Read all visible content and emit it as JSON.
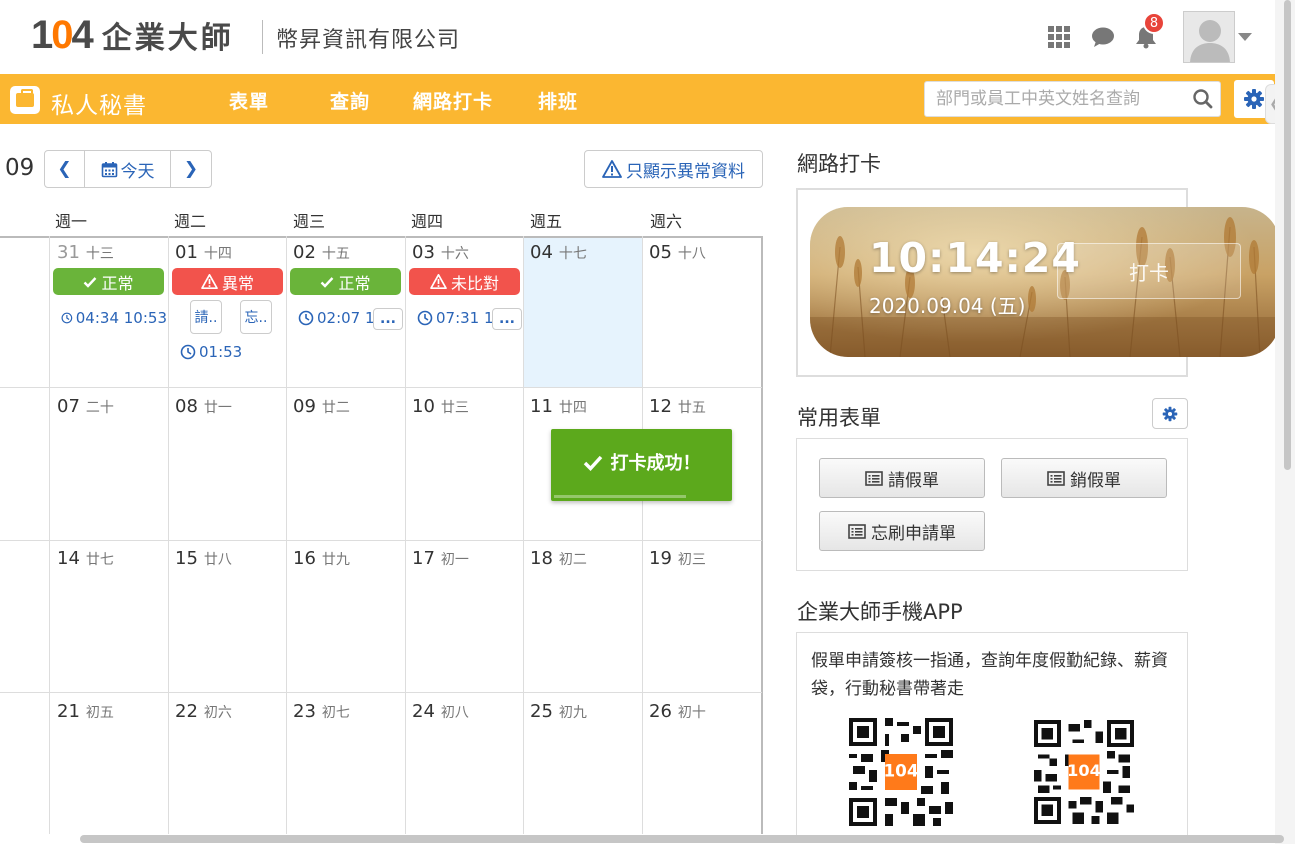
{
  "header": {
    "logo_number": "1",
    "logo_zero": "0",
    "logo_four": "4",
    "logo_text": "企業大師",
    "company": "幣昇資訊有限公司",
    "notification_count": "8",
    "icons": [
      "apps-grid-icon",
      "chat-icon",
      "bell-icon",
      "avatar-icon",
      "caret-down-icon"
    ]
  },
  "nav": {
    "brand": "私人秘書",
    "items": [
      "表單",
      "查詢",
      "網路打卡",
      "排班"
    ],
    "search_placeholder": "部門或員工中英文姓名查詢",
    "accent_color": "#fbb731"
  },
  "calendar": {
    "month": "09",
    "today_label": "今天",
    "anomaly_label": "只顯示異常資料",
    "weekdays": [
      "週一",
      "週二",
      "週三",
      "週四",
      "週五",
      "週六"
    ],
    "weeks": [
      [
        {
          "d": "31",
          "l": "十三"
        },
        {
          "d": "01",
          "l": "十四"
        },
        {
          "d": "02",
          "l": "十五"
        },
        {
          "d": "03",
          "l": "十六"
        },
        {
          "d": "04",
          "l": "十七"
        },
        {
          "d": "05",
          "l": "十八"
        }
      ],
      [
        {
          "d": "07",
          "l": "二十"
        },
        {
          "d": "08",
          "l": "廿一"
        },
        {
          "d": "09",
          "l": "廿二"
        },
        {
          "d": "10",
          "l": "廿三"
        },
        {
          "d": "11",
          "l": "廿四"
        },
        {
          "d": "12",
          "l": "廿五"
        }
      ],
      [
        {
          "d": "14",
          "l": "廿七"
        },
        {
          "d": "15",
          "l": "廿八"
        },
        {
          "d": "16",
          "l": "廿九"
        },
        {
          "d": "17",
          "l": "初一"
        },
        {
          "d": "18",
          "l": "初二"
        },
        {
          "d": "19",
          "l": "初三"
        }
      ],
      [
        {
          "d": "21",
          "l": "初五"
        },
        {
          "d": "22",
          "l": "初六"
        },
        {
          "d": "23",
          "l": "初七"
        },
        {
          "d": "24",
          "l": "初八"
        },
        {
          "d": "25",
          "l": "初九"
        },
        {
          "d": "26",
          "l": "初十"
        }
      ]
    ],
    "status": {
      "mon": "正常",
      "tue": "異常",
      "wed": "正常",
      "thu": "未比對"
    },
    "times": {
      "mon": "04:34 10:53",
      "tue": "01:53",
      "wed": "02:07 1(",
      "thu": "07:31 1("
    },
    "chips": {
      "leave": "請..",
      "forgot": "忘..",
      "more": "..."
    },
    "status_colors": {
      "ok": "#6ab43a",
      "bad": "#f2534c"
    },
    "toast": "打卡成功！"
  },
  "punch": {
    "title": "網路打卡",
    "time": "10:14:24",
    "date": "2020.09.04 (五)",
    "button": "打卡"
  },
  "forms": {
    "title": "常用表單",
    "buttons": [
      "請假單",
      "銷假單",
      "忘刷申請單"
    ]
  },
  "app": {
    "title": "企業大師手機APP",
    "desc": "假單申請簽核一指通，查詢年度假勤紀錄、薪資袋，行動秘書帶著走",
    "qr_logo": "104"
  }
}
